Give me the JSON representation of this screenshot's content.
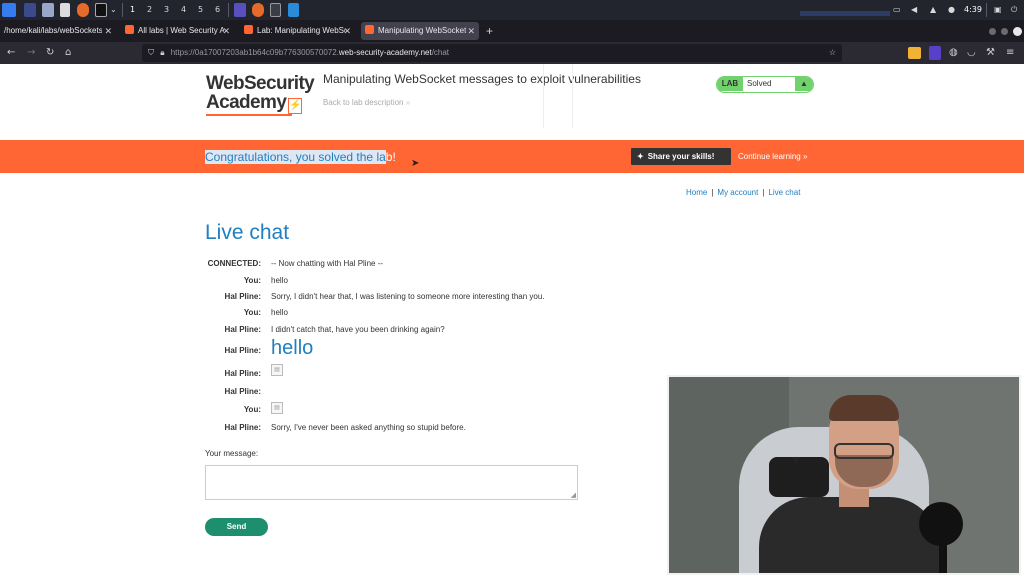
{
  "os_panel": {
    "workspaces": [
      "1",
      "2",
      "3",
      "4",
      "5",
      "6"
    ],
    "clock": "4:39"
  },
  "tabs": [
    {
      "label": "/home/kali/labs/webSockets"
    },
    {
      "label": "All labs | Web Security Ac"
    },
    {
      "label": "Lab: Manipulating WebSo"
    },
    {
      "label": "Manipulating WebSocket"
    }
  ],
  "nav": {
    "url_prefix": "https://0a17007203ab1b64c09b776300570072.",
    "url_host": "web-security-academy.net",
    "url_path": "/chat"
  },
  "header": {
    "logo_line1": "WebSecurity",
    "logo_line2": "Academy",
    "logo_bolt": "⚡",
    "lab_title": "Manipulating WebSocket messages to exploit vulnerabilities",
    "back_link": "Back to lab description",
    "back_arrow": "»",
    "lab_badge": "LAB",
    "lab_state": "Solved",
    "lab_icon": "flask-icon"
  },
  "banner": {
    "congrats_selected": "Congratulations, you solved the la",
    "congrats_rest": "b!",
    "share_label": "Share your skills!",
    "continue_label": "Continue learning",
    "continue_arrow": "»"
  },
  "topnav": {
    "home": "Home",
    "separator": "|",
    "account": "My account",
    "live_chat": "Live chat"
  },
  "chat": {
    "title": "Live chat",
    "rows": [
      {
        "who": "CONNECTED:",
        "msg": "-- Now chatting with Hal Pline --"
      },
      {
        "who": "You:",
        "msg": "hello"
      },
      {
        "who": "Hal Pline:",
        "msg": "Sorry, I didn't hear that, I was listening to someone more interesting than you."
      },
      {
        "who": "You:",
        "msg": "hello"
      },
      {
        "who": "Hal Pline:",
        "msg": "I didn't catch that, have you been drinking again?"
      },
      {
        "who": "Hal Pline:",
        "msg": "hello"
      },
      {
        "who": "Hal Pline:",
        "msg": ""
      },
      {
        "who": "Hal Pline:",
        "msg": ""
      },
      {
        "who": "You:",
        "msg": ""
      },
      {
        "who": "Hal Pline:",
        "msg": "Sorry, I've never been asked anything so stupid before."
      }
    ],
    "message_label": "Your message:",
    "message_value": "",
    "send_label": "Send"
  },
  "colors": {
    "accent_orange": "#ff6633",
    "link_blue": "#1f7fc0",
    "solved_green": "#70d16d",
    "send_green": "#1d8f6e"
  }
}
